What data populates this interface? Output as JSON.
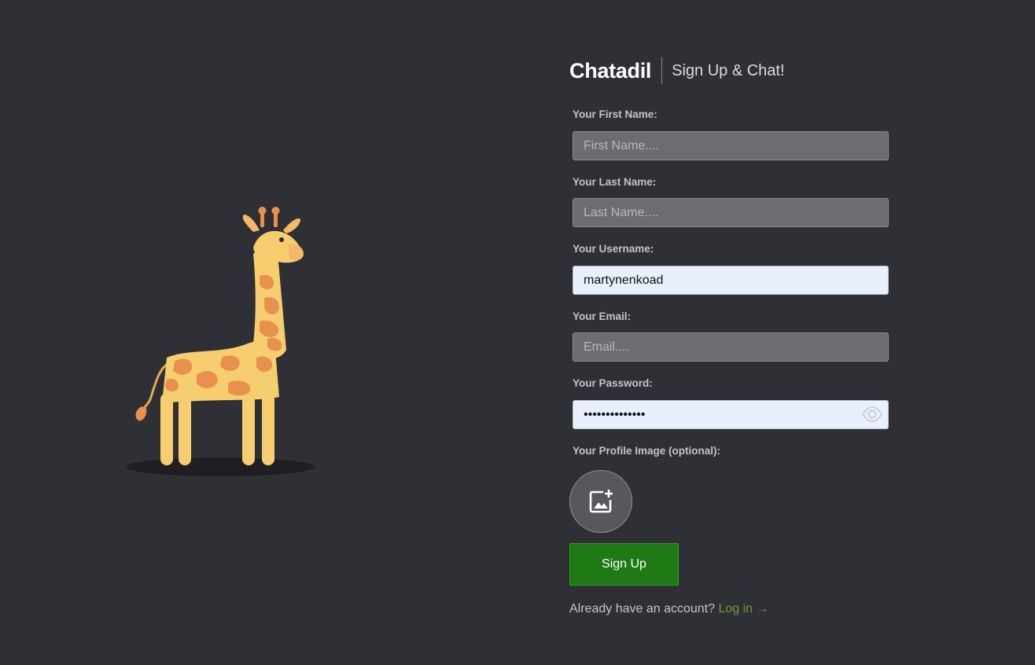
{
  "brand": {
    "name": "Chatadil",
    "tagline": "Sign Up & Chat!"
  },
  "form": {
    "first_name": {
      "label": "Your First Name:",
      "placeholder": "First Name....",
      "value": ""
    },
    "last_name": {
      "label": "Your Last Name:",
      "placeholder": "Last Name....",
      "value": ""
    },
    "username": {
      "label": "Your Username:",
      "placeholder": "",
      "value": "martynenkoad"
    },
    "email": {
      "label": "Your Email:",
      "placeholder": "Email....",
      "value": ""
    },
    "password": {
      "label": "Your Password:",
      "value": "••••••••••••••"
    },
    "profile_image": {
      "label": "Your Profile Image (optional):",
      "icon": "add-image-icon"
    },
    "submit_label": "Sign Up"
  },
  "footer": {
    "prompt": "Already have an account?",
    "login_link": "Log in →"
  },
  "icons": {
    "password_toggle": "eye-icon",
    "illustration": "giraffe-illustration"
  },
  "colors": {
    "background": "#2f3035",
    "input_bg": "#6c6d72",
    "input_autofill_bg": "#e8f0fe",
    "primary_button": "#1f7a15",
    "link": "#6e9a3d"
  }
}
